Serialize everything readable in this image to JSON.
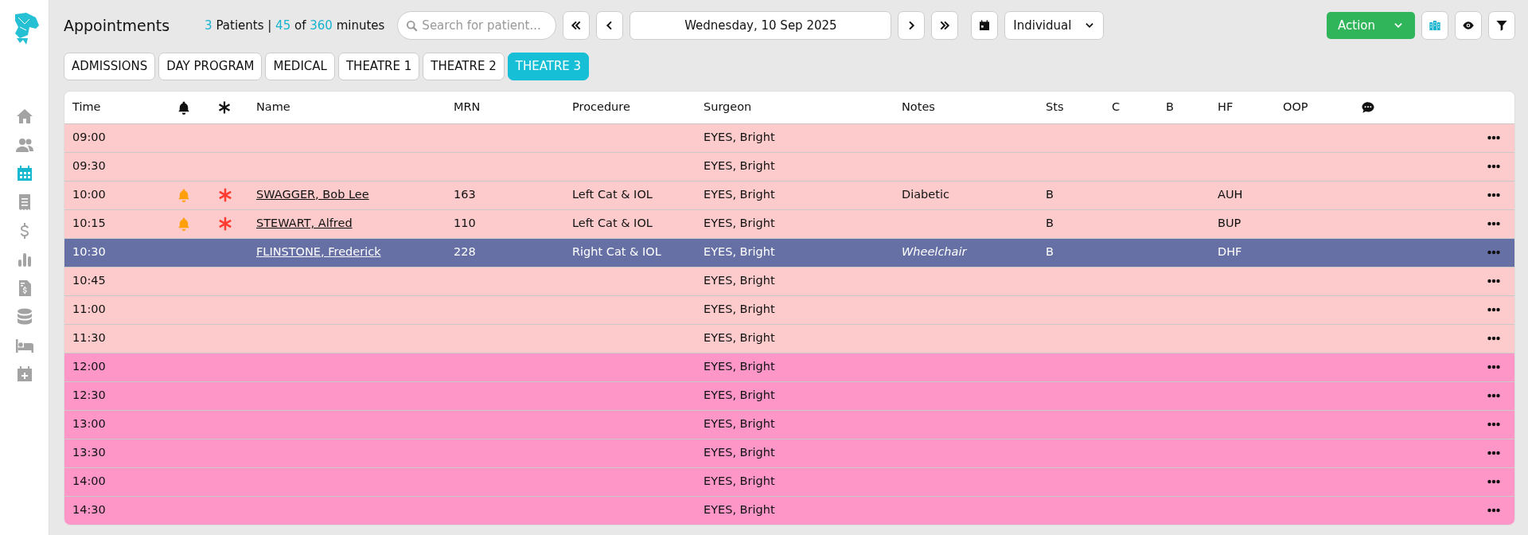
{
  "sidebar": {
    "items": [
      {
        "selected": false
      },
      {
        "selected": false
      },
      {
        "selected": true
      },
      {
        "selected": false
      },
      {
        "selected": false
      },
      {
        "selected": false
      },
      {
        "selected": false
      },
      {
        "selected": false
      },
      {
        "selected": false
      },
      {
        "selected": false
      }
    ]
  },
  "header": {
    "title": "Appointments",
    "stats": [
      {
        "text": "3",
        "highlight": true
      },
      {
        "text": "Patients |",
        "highlight": false
      },
      {
        "text": "45",
        "highlight": true
      },
      {
        "text": "of",
        "highlight": false
      },
      {
        "text": "360",
        "highlight": true
      },
      {
        "text": "minutes",
        "highlight": false
      }
    ],
    "search": {
      "placeholder": "Search for patient..."
    },
    "date": "Wednesday, 10 Sep 2025",
    "view": "Individual",
    "action": "Action"
  },
  "tabs": [
    {
      "label": "ADMISSIONS",
      "selected": false
    },
    {
      "label": "DAY PROGRAM",
      "selected": false
    },
    {
      "label": "MEDICAL",
      "selected": false
    },
    {
      "label": "THEATRE 1",
      "selected": false
    },
    {
      "label": "THEATRE 2",
      "selected": false
    },
    {
      "label": "THEATRE 3",
      "selected": true
    }
  ],
  "table": {
    "columns": [
      {
        "label": "Time",
        "kind": "text"
      },
      {
        "kind": "bell"
      },
      {
        "kind": "asterisk"
      },
      {
        "label": "Name",
        "kind": "text"
      },
      {
        "label": "MRN",
        "kind": "text"
      },
      {
        "label": "Procedure",
        "kind": "text"
      },
      {
        "label": "Surgeon",
        "kind": "text"
      },
      {
        "label": "Notes",
        "kind": "text"
      },
      {
        "label": "Sts",
        "kind": "text"
      },
      {
        "label": "C",
        "kind": "text"
      },
      {
        "label": "B",
        "kind": "text"
      },
      {
        "label": "HF",
        "kind": "text"
      },
      {
        "label": "OOP",
        "kind": "text"
      },
      {
        "kind": "comment"
      }
    ],
    "rows": [
      {
        "time": "09:00",
        "surgeon": "EYES, Bright",
        "color": "#fdcbcb",
        "selected": false,
        "alert": false,
        "flag": false
      },
      {
        "time": "09:30",
        "surgeon": "EYES, Bright",
        "color": "#fdcbcb",
        "selected": false,
        "alert": false,
        "flag": false
      },
      {
        "time": "10:00",
        "name": "SWAGGER, Bob Lee",
        "mrn": "163",
        "procedure": "Left Cat & IOL",
        "surgeon": "EYES, Bright",
        "notes": "Diabetic",
        "notes_italic": false,
        "sts": "B",
        "hf": "AUH",
        "color": "#fdcbcb",
        "selected": false,
        "alert": true,
        "flag": true
      },
      {
        "time": "10:15",
        "name": "STEWART, Alfred",
        "mrn": "110",
        "procedure": "Left Cat & IOL",
        "surgeon": "EYES, Bright",
        "sts": "B",
        "hf": "BUP",
        "color": "#fdcbcb",
        "selected": false,
        "alert": true,
        "flag": true
      },
      {
        "time": "10:30",
        "name": "FLINSTONE, Frederick",
        "mrn": "228",
        "procedure": "Right Cat & IOL",
        "surgeon": "EYES, Bright",
        "notes": "Wheelchair",
        "notes_italic": true,
        "sts": "B",
        "hf": "DHF",
        "selected": true,
        "alert": false,
        "flag": false
      },
      {
        "time": "10:45",
        "surgeon": "EYES, Bright",
        "color": "#fdcbcb",
        "selected": false,
        "alert": false,
        "flag": false
      },
      {
        "time": "11:00",
        "surgeon": "EYES, Bright",
        "color": "#fdcbcb",
        "selected": false,
        "alert": false,
        "flag": false
      },
      {
        "time": "11:30",
        "surgeon": "EYES, Bright",
        "color": "#fdcbcb",
        "selected": false,
        "alert": false,
        "flag": false
      },
      {
        "time": "12:00",
        "surgeon": "EYES, Bright",
        "color": "#fe97c8",
        "selected": false,
        "alert": false,
        "flag": false
      },
      {
        "time": "12:30",
        "surgeon": "EYES, Bright",
        "color": "#fe97c8",
        "selected": false,
        "alert": false,
        "flag": false
      },
      {
        "time": "13:00",
        "surgeon": "EYES, Bright",
        "color": "#fe97c8",
        "selected": false,
        "alert": false,
        "flag": false
      },
      {
        "time": "13:30",
        "surgeon": "EYES, Bright",
        "color": "#fe97c8",
        "selected": false,
        "alert": false,
        "flag": false
      },
      {
        "time": "14:00",
        "surgeon": "EYES, Bright",
        "color": "#fe97c8",
        "selected": false,
        "alert": false,
        "flag": false
      },
      {
        "time": "14:30",
        "surgeon": "EYES, Bright",
        "color": "#fe97c8",
        "selected": false,
        "alert": false,
        "flag": false
      }
    ]
  }
}
